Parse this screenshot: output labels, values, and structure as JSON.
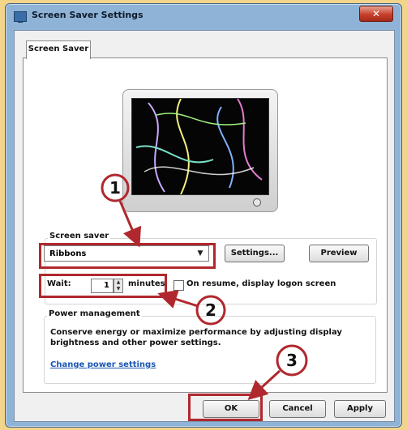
{
  "window": {
    "title": "Screen Saver Settings",
    "close_symbol": "✕"
  },
  "tabs": [
    {
      "label": "Screen Saver",
      "active": true
    }
  ],
  "screen_saver": {
    "group_label": "Screen saver",
    "selected": "Ribbons",
    "settings_label": "Settings...",
    "preview_label": "Preview",
    "wait_label": "Wait:",
    "wait_value": "1",
    "minutes_label": "minutes",
    "logon_checkbox_label": "On resume, display logon screen",
    "logon_checked": false
  },
  "power_management": {
    "group_label": "Power management",
    "description": "Conserve energy or maximize performance by adjusting display brightness and other power settings.",
    "link_label": "Change power settings"
  },
  "buttons": {
    "ok": "OK",
    "cancel": "Cancel",
    "apply": "Apply"
  },
  "annotations": {
    "step1": "1",
    "step2": "2",
    "step3": "3",
    "highlight_color": "#b0282e"
  },
  "icons": {
    "app": "monitor-icon",
    "close": "close-icon",
    "dropdown": "chevron-down-icon"
  }
}
